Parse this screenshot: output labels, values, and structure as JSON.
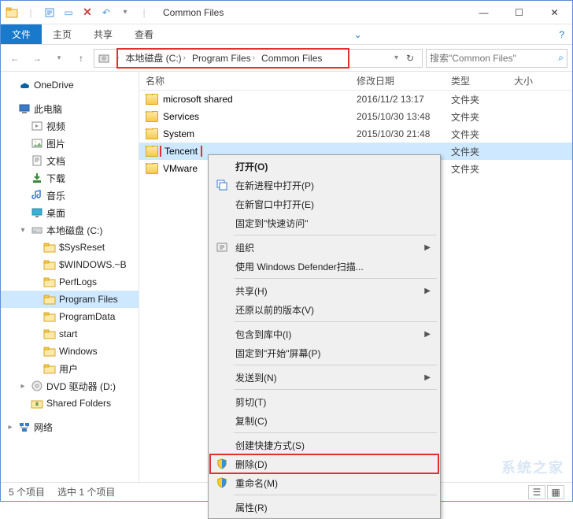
{
  "window": {
    "title": "Common Files",
    "min": "—",
    "max": "☐",
    "close": "✕"
  },
  "ribbon": {
    "file": "文件",
    "home": "主页",
    "share": "共享",
    "view": "查看"
  },
  "breadcrumb": {
    "root_icon": "▸",
    "items": [
      "本地磁盘 (C:)",
      "Program Files",
      "Common Files"
    ],
    "refresh": "↻"
  },
  "search": {
    "placeholder": "搜索\"Common Files\"",
    "icon": "🔍"
  },
  "nav": [
    {
      "level": 0,
      "expand": "",
      "icon": "onedrive",
      "label": "OneDrive"
    },
    {
      "level": 0,
      "expand": "",
      "icon": "pc",
      "label": "此电脑",
      "spaceBefore": true
    },
    {
      "level": 1,
      "expand": "",
      "icon": "video",
      "label": "视频"
    },
    {
      "level": 1,
      "expand": "",
      "icon": "pictures",
      "label": "图片"
    },
    {
      "level": 1,
      "expand": "",
      "icon": "docs",
      "label": "文档"
    },
    {
      "level": 1,
      "expand": "",
      "icon": "downloads",
      "label": "下载"
    },
    {
      "level": 1,
      "expand": "",
      "icon": "music",
      "label": "音乐"
    },
    {
      "level": 1,
      "expand": "",
      "icon": "desktop",
      "label": "桌面"
    },
    {
      "level": 1,
      "expand": "▾",
      "icon": "disk",
      "label": "本地磁盘 (C:)"
    },
    {
      "level": 2,
      "expand": "",
      "icon": "folder",
      "label": "$SysReset"
    },
    {
      "level": 2,
      "expand": "",
      "icon": "folder",
      "label": "$WINDOWS.~B"
    },
    {
      "level": 2,
      "expand": "",
      "icon": "folder",
      "label": "PerfLogs"
    },
    {
      "level": 2,
      "expand": "",
      "icon": "folder",
      "label": "Program Files",
      "selected": true
    },
    {
      "level": 2,
      "expand": "",
      "icon": "folder",
      "label": "ProgramData"
    },
    {
      "level": 2,
      "expand": "",
      "icon": "folder",
      "label": "start"
    },
    {
      "level": 2,
      "expand": "",
      "icon": "folder",
      "label": "Windows"
    },
    {
      "level": 2,
      "expand": "",
      "icon": "folder",
      "label": "用户"
    },
    {
      "level": 1,
      "expand": "▸",
      "icon": "dvd",
      "label": "DVD 驱动器 (D:)"
    },
    {
      "level": 1,
      "expand": "",
      "icon": "shared",
      "label": "Shared Folders"
    },
    {
      "level": 0,
      "expand": "▸",
      "icon": "network",
      "label": "网络",
      "spaceBefore": true
    }
  ],
  "columns": {
    "name": "名称",
    "date": "修改日期",
    "type": "类型",
    "size": "大小"
  },
  "rows": [
    {
      "name": "microsoft shared",
      "date": "2016/11/2 13:17",
      "type": "文件夹"
    },
    {
      "name": "Services",
      "date": "2015/10/30 13:48",
      "type": "文件夹"
    },
    {
      "name": "System",
      "date": "2015/10/30 21:48",
      "type": "文件夹"
    },
    {
      "name": "Tencent",
      "date": "",
      "type": "文件夹",
      "selected": true
    },
    {
      "name": "VMware",
      "date": "",
      "type": "文件夹"
    }
  ],
  "menu": [
    {
      "t": "item",
      "label": "打开(O)",
      "bold": true
    },
    {
      "t": "item",
      "label": "在新进程中打开(P)",
      "icon": "newproc"
    },
    {
      "t": "item",
      "label": "在新窗口中打开(E)"
    },
    {
      "t": "item",
      "label": "固定到\"快速访问\""
    },
    {
      "t": "sep"
    },
    {
      "t": "item",
      "label": "组织",
      "icon": "org",
      "submenu": true
    },
    {
      "t": "item",
      "label": "使用 Windows Defender扫描..."
    },
    {
      "t": "sep"
    },
    {
      "t": "item",
      "label": "共享(H)",
      "submenu": true
    },
    {
      "t": "item",
      "label": "还原以前的版本(V)"
    },
    {
      "t": "sep"
    },
    {
      "t": "item",
      "label": "包含到库中(I)",
      "submenu": true
    },
    {
      "t": "item",
      "label": "固定到\"开始\"屏幕(P)"
    },
    {
      "t": "sep"
    },
    {
      "t": "item",
      "label": "发送到(N)",
      "submenu": true
    },
    {
      "t": "sep"
    },
    {
      "t": "item",
      "label": "剪切(T)"
    },
    {
      "t": "item",
      "label": "复制(C)"
    },
    {
      "t": "sep"
    },
    {
      "t": "item",
      "label": "创建快捷方式(S)"
    },
    {
      "t": "item",
      "label": "删除(D)",
      "icon": "shield",
      "hl": true
    },
    {
      "t": "item",
      "label": "重命名(M)",
      "icon": "shield"
    },
    {
      "t": "sep"
    },
    {
      "t": "item",
      "label": "属性(R)"
    }
  ],
  "status": {
    "count": "5 个项目",
    "selected": "选中 1 个项目"
  },
  "watermark": "系统之家"
}
